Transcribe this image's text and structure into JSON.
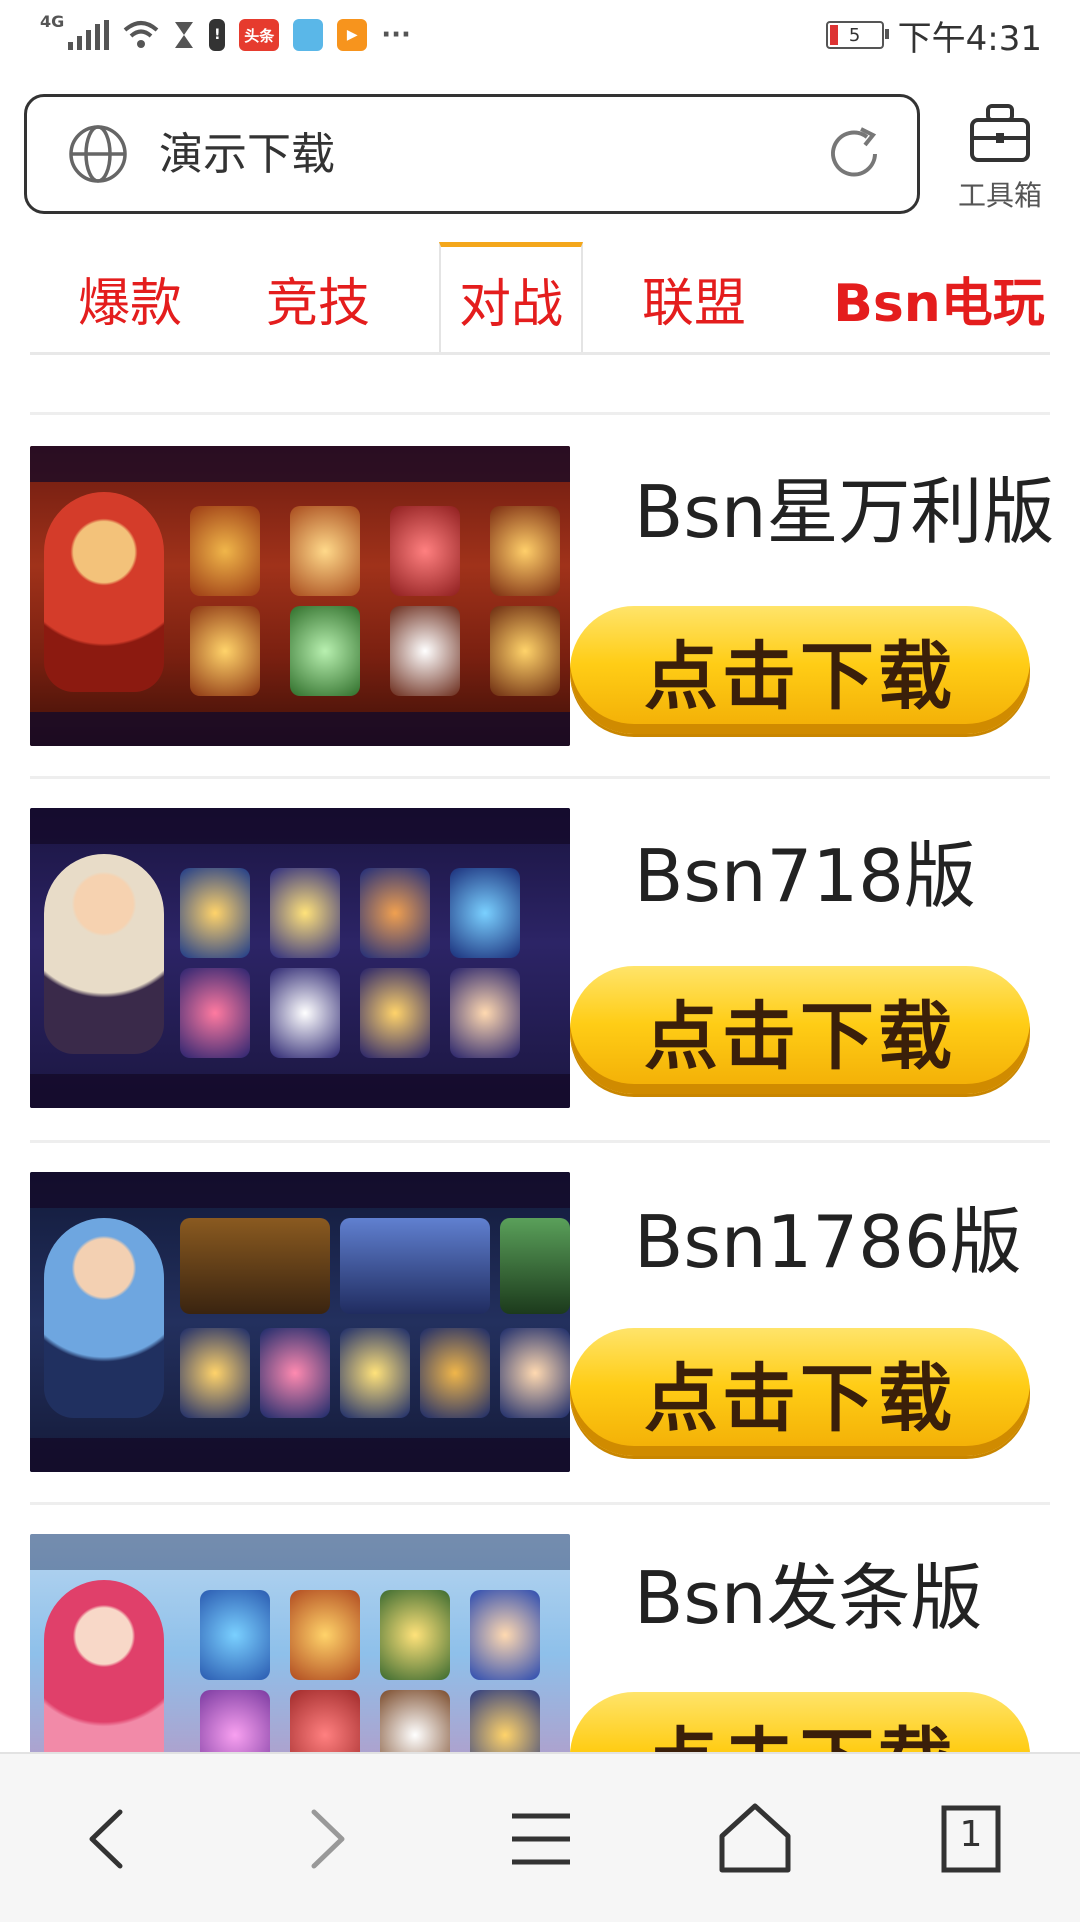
{
  "status_bar": {
    "network": "4G",
    "app_badge": "头条",
    "more": "···",
    "battery_level": "5",
    "time": "下午4:31"
  },
  "browser": {
    "url_text": "演示下载",
    "toolbox_label": "工具箱"
  },
  "tabs": [
    {
      "label": "爆款"
    },
    {
      "label": "竞技"
    },
    {
      "label": "对战",
      "active": true
    },
    {
      "label": "联盟"
    },
    {
      "label": "Bsn电玩"
    }
  ],
  "items": [
    {
      "title": "Bsn星万利版",
      "button": "点击下载"
    },
    {
      "title": "Bsn718版",
      "button": "点击下载"
    },
    {
      "title": "Bsn1786版",
      "button": "点击下载"
    },
    {
      "title": "Bsn发条版",
      "button": "点击下载"
    }
  ],
  "bottom_nav": {
    "tab_count": "1",
    "icons": [
      "back-icon",
      "forward-icon",
      "menu-icon",
      "home-icon",
      "tabs-icon"
    ]
  },
  "colors": {
    "tab_text": "#e41d1d",
    "active_tab_indicator": "#f4a71b",
    "download_button": "#ffcd16"
  }
}
